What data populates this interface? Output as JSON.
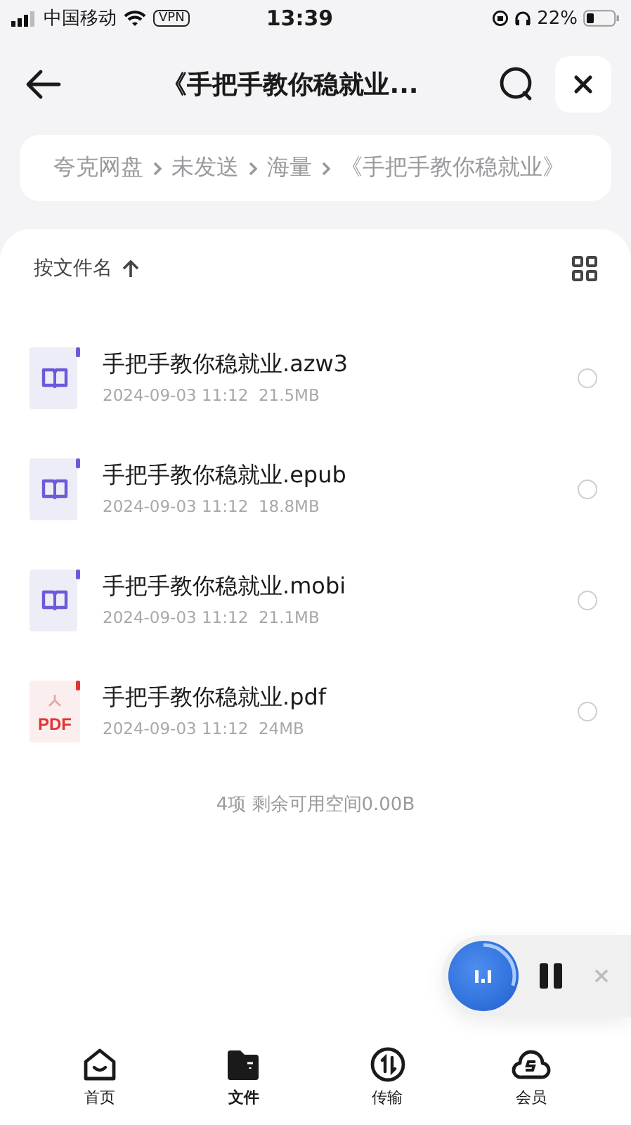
{
  "status_bar": {
    "carrier": "中国移动",
    "vpn": "VPN",
    "time": "13:39",
    "battery": "22%"
  },
  "header": {
    "title": "《手把手教你稳就业..."
  },
  "breadcrumb": [
    "夸克网盘",
    "未发送",
    "海量",
    "《手把手教你稳就业》"
  ],
  "sort": {
    "label": "按文件名"
  },
  "files": [
    {
      "name": "手把手教你稳就业.azw3",
      "meta": "2024-09-03 11:12  21.5MB",
      "kind": "book",
      "selected": false
    },
    {
      "name": "手把手教你稳就业.epub",
      "meta": "2024-09-03 11:12  18.8MB",
      "kind": "book",
      "selected": false
    },
    {
      "name": "手把手教你稳就业.mobi",
      "meta": "2024-09-03 11:12  21.1MB",
      "kind": "book",
      "selected": false
    },
    {
      "name": "手把手教你稳就业.pdf",
      "meta": "2024-09-03 11:12  24MB",
      "kind": "pdf",
      "badge": "PDF",
      "selected": false
    }
  ],
  "summary": "4项 剩余可用空间0.00B",
  "player": {
    "level": 0.3
  },
  "tabs": [
    {
      "label": "首页",
      "kind": "home",
      "selected": false
    },
    {
      "label": "文件",
      "kind": "folder",
      "selected": true
    },
    {
      "label": "传输",
      "kind": "transfer",
      "selected": false
    },
    {
      "label": "会员",
      "kind": "vip",
      "selected": false
    }
  ]
}
